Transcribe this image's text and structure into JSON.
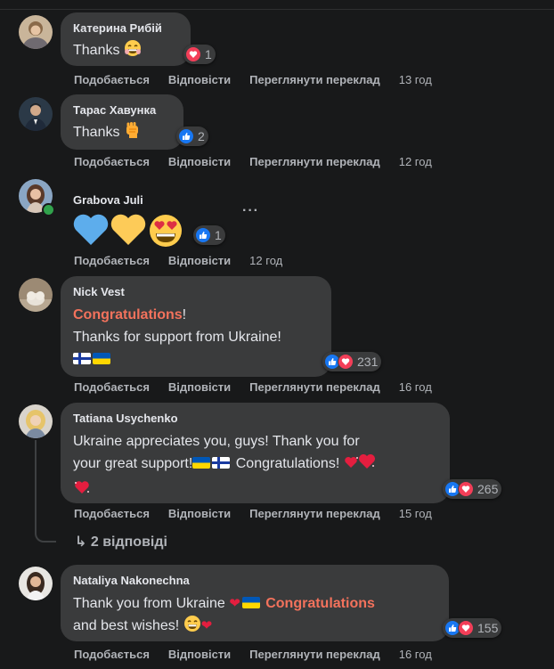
{
  "actions": {
    "like": "Подобається",
    "reply": "Відповісти",
    "translate": "Переглянути переклад"
  },
  "comments": [
    {
      "author": "Катерина Рибій",
      "text": "Thanks",
      "reactions": [
        "love"
      ],
      "reaction_count": "1",
      "time": "13 год"
    },
    {
      "author": "Тарас Хавунка",
      "text": "Thanks",
      "reactions": [
        "like"
      ],
      "reaction_count": "2",
      "time": "12 год"
    },
    {
      "author": "Grabova Juli",
      "reactions": [
        "like"
      ],
      "reaction_count": "1",
      "time": "12 год",
      "online": true
    },
    {
      "author": "Nick Vest",
      "highlight": "Congratulations",
      "text_after_highlight": "!",
      "line2": "Thanks for support from Ukraine!",
      "reactions": [
        "like",
        "love"
      ],
      "reaction_count": "231",
      "time": "16 год"
    },
    {
      "author": "Tatiana Usychenko",
      "line1": "Ukraine appreciates you, guys! Thank you for",
      "line2_prefix": "your great support!",
      "line2_suffix": " Congratulations!",
      "reactions": [
        "like",
        "love"
      ],
      "reaction_count": "265",
      "time": "15 год",
      "replies": "2 відповіді"
    },
    {
      "author": "Nataliya Nakonechna",
      "line1_prefix": "Thank you from Ukraine ",
      "highlight": "Congratulations",
      "line2": "and best wishes!",
      "reactions": [
        "like",
        "love"
      ],
      "reaction_count": "155",
      "time": "16 год"
    }
  ],
  "colors": {
    "background": "#18191a",
    "bubble": "#3a3b3c",
    "highlight": "#f3725c",
    "like": "#1877f2",
    "love": "#f33e58"
  }
}
